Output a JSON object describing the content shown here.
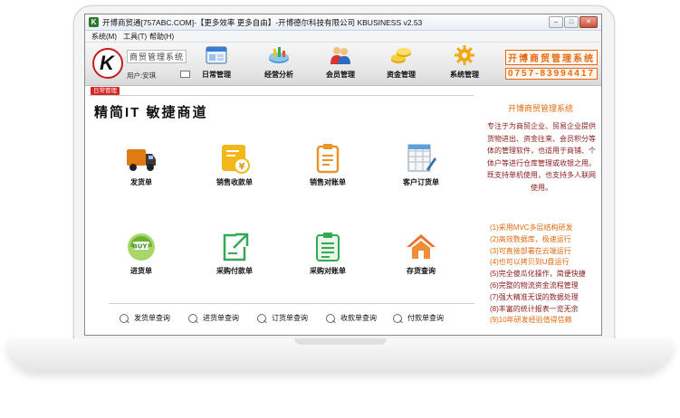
{
  "window": {
    "title": "开博商贸通[757ABC.COM]-【更多效率 更多自由】-开博德尔科技有限公司  KBUSINESS v2.53",
    "app_icon": "K",
    "controls": [
      "minimize",
      "maximize",
      "close"
    ]
  },
  "menu": [
    {
      "label": "系统(M)"
    },
    {
      "label": "工具(T)"
    },
    {
      "label": "帮助(H)"
    }
  ],
  "toolbar": {
    "brand": "商贸管理系统",
    "user": "用户:安琪",
    "items": [
      {
        "label": "日常管理",
        "icon": "daily-window-icon"
      },
      {
        "label": "经营分析",
        "icon": "chart-disc-icon"
      },
      {
        "label": "会员管理",
        "icon": "members-icon"
      },
      {
        "label": "资金管理",
        "icon": "coins-icon"
      },
      {
        "label": "系统管理",
        "icon": "gear-icon"
      }
    ],
    "phone_line1": "开博商贸管理系统",
    "phone_line2": "0757-83994417"
  },
  "tab_tag": "日常管理",
  "slogan": "精简IT 敏捷商道",
  "functions": [
    {
      "label": "发货单",
      "icon": "truck-icon"
    },
    {
      "label": "销售收款单",
      "icon": "yen-receipt-icon"
    },
    {
      "label": "销售对账单",
      "icon": "clipboard-icon"
    },
    {
      "label": "客户订货单",
      "icon": "spreadsheet-pen-icon"
    },
    {
      "label": "进货单",
      "icon": "buy-tag-icon"
    },
    {
      "label": "采购付款单",
      "icon": "export-edit-icon"
    },
    {
      "label": "采购对账单",
      "icon": "checklist-icon"
    },
    {
      "label": "存货查询",
      "icon": "house-icon"
    }
  ],
  "queries": [
    {
      "label": "发货单查询"
    },
    {
      "label": "进货单查询"
    },
    {
      "label": "订货单查询"
    },
    {
      "label": "收款单查询"
    },
    {
      "label": "付款单查询"
    }
  ],
  "right_panel": {
    "title": "开博商贸管理系统",
    "description": "专注于为商贸企业、贸易企业提供货物进出、资金往来、会员积分等体的管理软件，也适用于商铺、个体户等进行仓库管理或收银之用。既支持单机使用，也支持多人联网使用。",
    "features": [
      "(1)采用MVC多层结构研发",
      "(2)高效数据库，极速运行",
      "(3)可直接部署在云端运行",
      "(4)也可以拷贝到U盘运行",
      "(5)完全傻瓜化操作，简便快捷",
      "(6)完整的物流资金流程管理",
      "(7)强大精准无误的数据处理",
      "(8)丰富的统计报表一览无余",
      "(9)10年研发经验值得信赖"
    ]
  },
  "colors": {
    "accent_orange": "#e06a12",
    "text_dark_red": "#8a1a1a",
    "tag_red": "#d42424"
  }
}
